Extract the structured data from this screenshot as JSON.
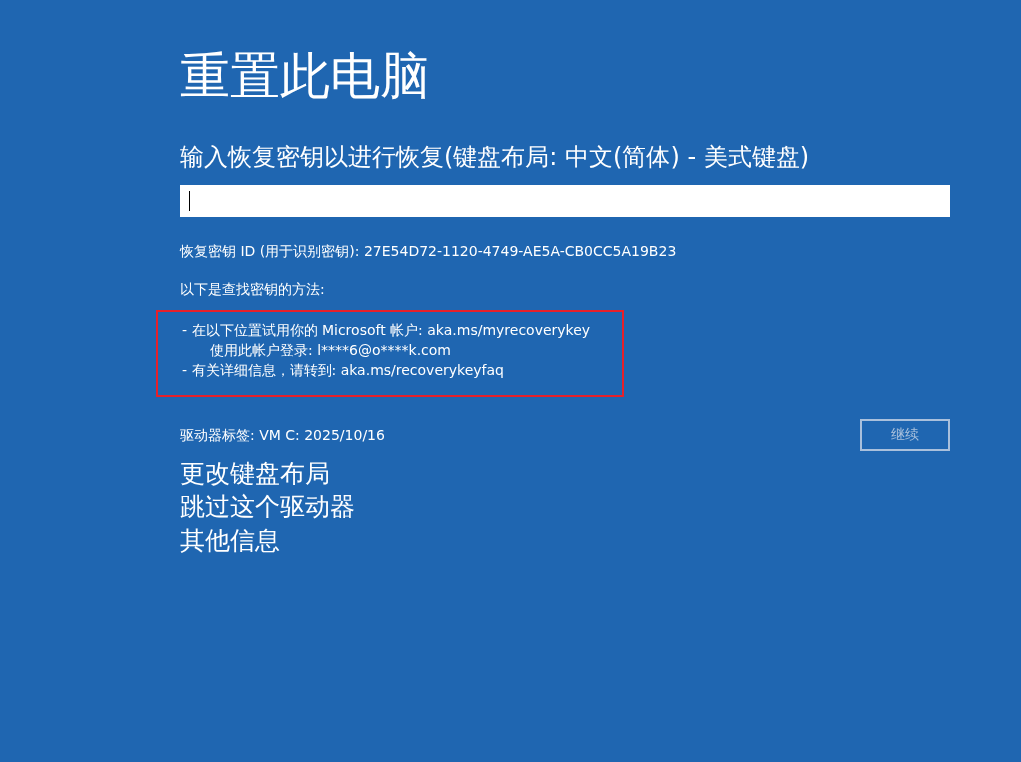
{
  "title": "重置此电脑",
  "prompt": "输入恢复密钥以进行恢复(键盘布局: 中文(简体) - 美式键盘)",
  "key_field": {
    "focused": true
  },
  "key_id": "恢复密钥 ID (用于识别密钥): 27E54D72-1120-4749-AE5A-CB0CC5A19B23",
  "methods_heading": "以下是查找密钥的方法:",
  "methods": {
    "highlighted": true,
    "lines": [
      {
        "kind": "item",
        "text": "- 在以下位置试用你的 Microsoft 帐户: aka.ms/myrecoverykey"
      },
      {
        "kind": "sub",
        "text": "使用此帐户登录: l****6@o****k.com"
      },
      {
        "kind": "item",
        "text": "- 有关详细信息，请转到: aka.ms/recoverykeyfaq"
      }
    ]
  },
  "drive_label": "驱动器标签: VM C: 2025/10/16",
  "continue_button": {
    "label": "继续",
    "disabled": true
  },
  "links": [
    "更改键盘布局",
    "跳过这个驱动器",
    "其他信息"
  ]
}
